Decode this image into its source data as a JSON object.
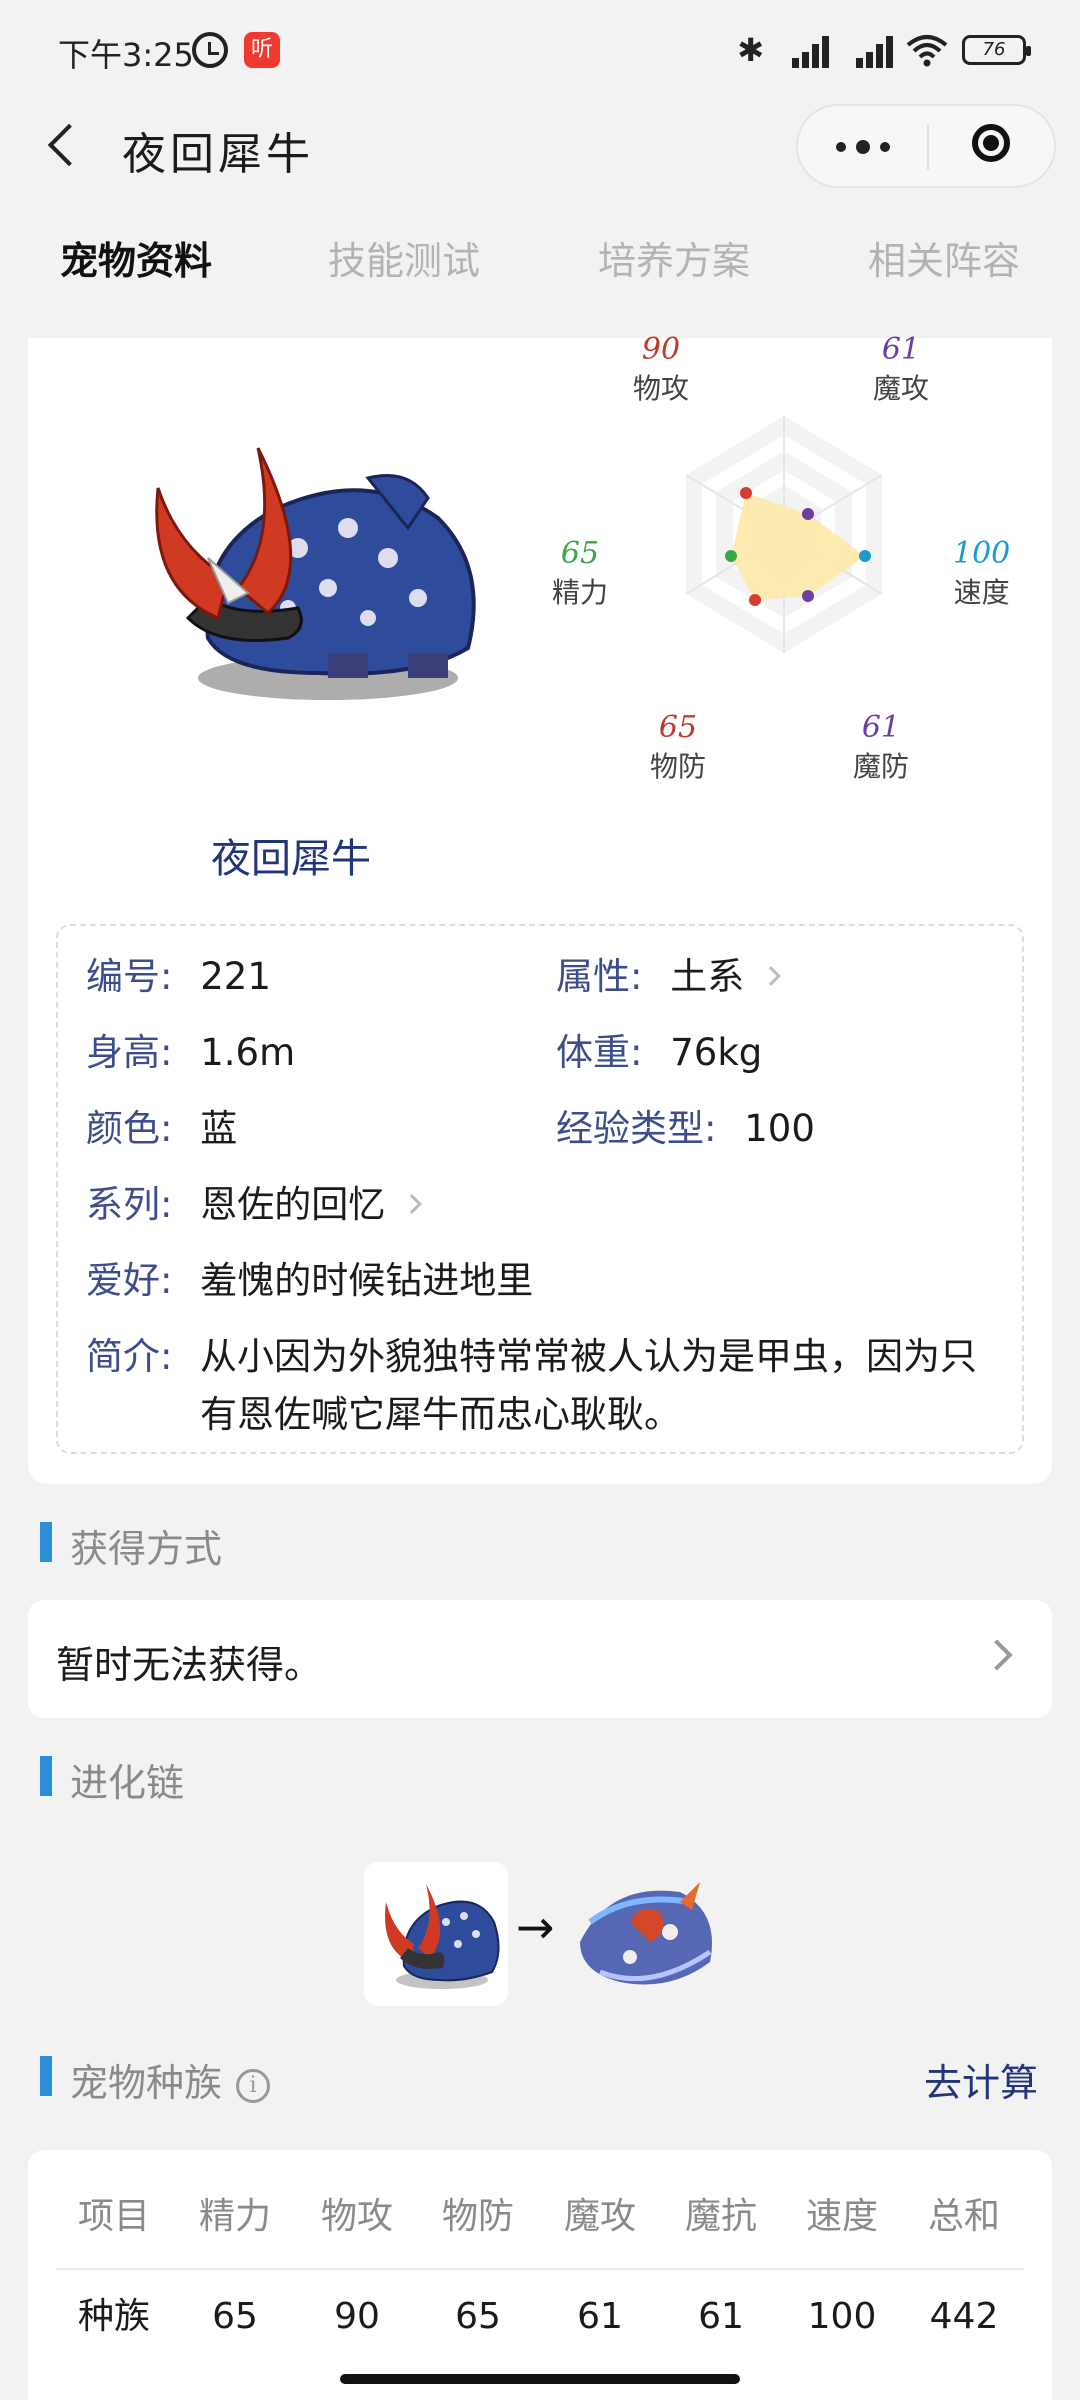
{
  "status_bar": {
    "time": "下午3:25",
    "app_badge": "听",
    "battery": "76"
  },
  "nav": {
    "title": "夜回犀牛"
  },
  "tabs": [
    "宠物资料",
    "技能测试",
    "培养方案",
    "相关阵容"
  ],
  "pet": {
    "name": "夜回犀牛"
  },
  "radar": {
    "stats": [
      {
        "name": "物攻",
        "value": "90",
        "color": "#c0392b"
      },
      {
        "name": "魔攻",
        "value": "61",
        "color": "#6b3fa0"
      },
      {
        "name": "速度",
        "value": "100",
        "color": "#1a9bd1"
      },
      {
        "name": "魔防",
        "value": "61",
        "color": "#6b3fa0"
      },
      {
        "name": "物防",
        "value": "65",
        "color": "#c0392b"
      },
      {
        "name": "精力",
        "value": "65",
        "color": "#3aa845"
      }
    ]
  },
  "info": {
    "number_label": "编号:",
    "number": "221",
    "attr_label": "属性:",
    "attr": "土系",
    "height_label": "身高:",
    "height": "1.6m",
    "weight_label": "体重:",
    "weight": "76kg",
    "color_label": "颜色:",
    "color": "蓝",
    "exp_label": "经验类型:",
    "exp": "100",
    "series_label": "系列:",
    "series": "恩佐的回忆",
    "hobby_label": "爱好:",
    "hobby": "羞愧的时候钻进地里",
    "intro_label": "简介:",
    "intro_line1": "从小因为外貌独特常常被人认为是甲虫，因为只",
    "intro_line2": "有恩佐喊它犀牛而忠心耿耿。"
  },
  "obtain": {
    "title": "获得方式",
    "text": "暂时无法获得。"
  },
  "evolution": {
    "title": "进化链",
    "arrow": "→"
  },
  "race": {
    "title": "宠物种族",
    "info_icon": "i",
    "calc_link": "去计算",
    "headers": [
      "项目",
      "精力",
      "物攻",
      "物防",
      "魔攻",
      "魔抗",
      "速度",
      "总和"
    ],
    "row": [
      "种族",
      "65",
      "90",
      "65",
      "61",
      "61",
      "100",
      "442"
    ]
  }
}
